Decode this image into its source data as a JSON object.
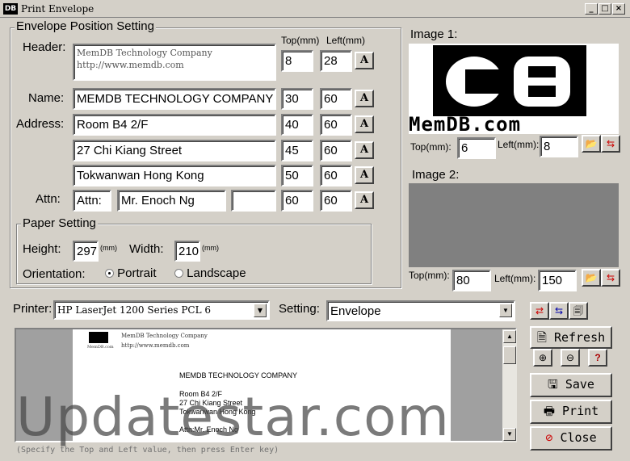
{
  "window": {
    "title": "Print Envelope",
    "icon_text": "DB"
  },
  "envelope": {
    "legend": "Envelope Position Setting",
    "col_top": "Top(mm)",
    "col_left": "Left(mm)",
    "header": {
      "label": "Header:",
      "line1": "MemDB Technology Company",
      "line2": "http://www.memdb.com",
      "top": "8",
      "left": "28"
    },
    "name": {
      "label": "Name:",
      "value": "MEMDB TECHNOLOGY COMPANY",
      "top": "30",
      "left": "60"
    },
    "address": {
      "label": "Address:",
      "lines": [
        {
          "value": "Room B4 2/F",
          "top": "40",
          "left": "60"
        },
        {
          "value": "27 Chi Kiang Street",
          "top": "45",
          "left": "60"
        },
        {
          "value": "Tokwanwan Hong Kong",
          "top": "50",
          "left": "60"
        }
      ]
    },
    "attn": {
      "label": "Attn:",
      "prefix": "Attn:",
      "value": "Mr. Enoch Ng",
      "extra": "",
      "top": "60",
      "left": "60"
    },
    "font_button": "A"
  },
  "paper": {
    "legend": "Paper Setting",
    "height_label": "Height:",
    "height": "297",
    "height_unit": "(mm)",
    "width_label": "Width:",
    "width": "210",
    "width_unit": "(mm)",
    "orientation_label": "Orientation:",
    "portrait": "Portrait",
    "landscape": "Landscape"
  },
  "image1": {
    "label": "Image 1:",
    "top_label": "Top(mm):",
    "top": "6",
    "left_label": "Left(mm):",
    "left": "8",
    "logo_text": "MemDB.com"
  },
  "image2": {
    "label": "Image 2:",
    "top_label": "Top(mm):",
    "top": "80",
    "left_label": "Left(mm):",
    "left": "150"
  },
  "printer": {
    "label": "Printer:",
    "value": "HP LaserJet 1200 Series PCL 6"
  },
  "setting": {
    "label": "Setting:",
    "value": "Envelope"
  },
  "preview": {
    "header1": "MemDB Technology Company",
    "header2": "http://www.memdb.com",
    "logo_small": "MemDB.com",
    "name": "MEMDB TECHNOLOGY COMPANY",
    "addr1": "Room B4 2/F",
    "addr2": "27 Chi Kiang Street",
    "addr3": "Tokwanwan Hong Kong",
    "attn": "Attn:Mr. Enoch Ng"
  },
  "buttons": {
    "refresh": "Refresh",
    "save": "Save",
    "print": "Print",
    "close": "Close"
  },
  "status": "(Specify the Top and Left value, then press Enter key)",
  "watermark": "Updatestar.com"
}
